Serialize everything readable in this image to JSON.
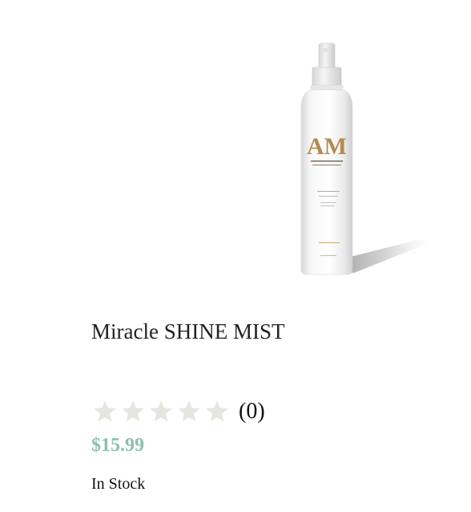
{
  "product": {
    "image_icon": "shine-mist-bottle",
    "brand_monogram": "AM",
    "brand_tagline": "Miracle SHINE MIST",
    "title": "Miracle SHINE MIST",
    "rating": {
      "stars_filled": 0,
      "stars_total": 5,
      "count_text": "(0)",
      "star_color": "#e6e6e0"
    },
    "price": "$15.99",
    "price_color": "#8bbfae",
    "stock_status": "In Stock"
  }
}
